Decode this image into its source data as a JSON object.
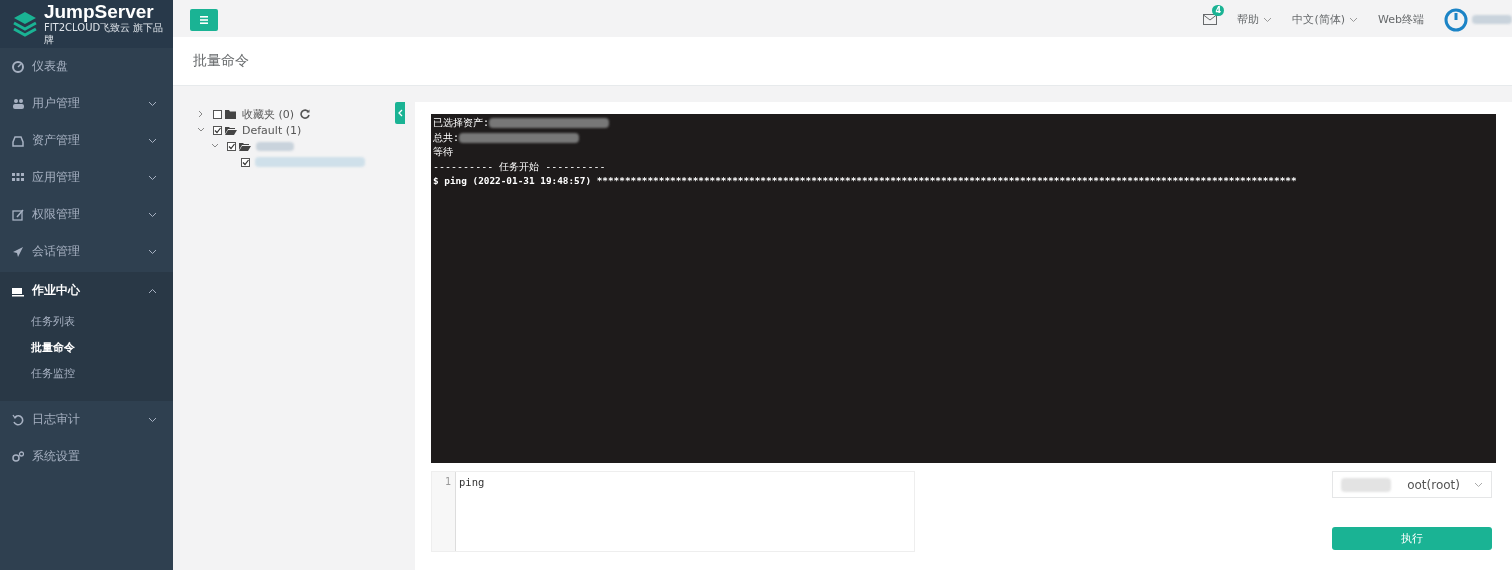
{
  "brand": {
    "name": "JumpServer",
    "tagline": "FIT2CLOUD飞致云 旗下品牌"
  },
  "sidebar": {
    "items": [
      {
        "label": "仪表盘",
        "expandable": false,
        "expanded": false
      },
      {
        "label": "用户管理",
        "expandable": true,
        "expanded": false
      },
      {
        "label": "资产管理",
        "expandable": true,
        "expanded": false
      },
      {
        "label": "应用管理",
        "expandable": true,
        "expanded": false
      },
      {
        "label": "权限管理",
        "expandable": true,
        "expanded": false
      },
      {
        "label": "会话管理",
        "expandable": true,
        "expanded": false
      },
      {
        "label": "作业中心",
        "expandable": true,
        "expanded": true,
        "children": [
          {
            "label": "任务列表",
            "selected": false
          },
          {
            "label": "批量命令",
            "selected": true
          },
          {
            "label": "任务监控",
            "selected": false
          }
        ]
      },
      {
        "label": "日志审计",
        "expandable": true,
        "expanded": false
      },
      {
        "label": "系统设置",
        "expandable": false,
        "expanded": false
      }
    ]
  },
  "topbar": {
    "notification_count": "4",
    "help": "帮助",
    "language": "中文(简体)",
    "web_terminal": "Web终端"
  },
  "page_title": "批量命令",
  "tree": [
    {
      "label": "收藏夹 (0)",
      "checked": false,
      "expanded": false,
      "refreshable": true
    },
    {
      "label": "Default (1)",
      "checked": true,
      "expanded": true,
      "children": [
        {
          "checked": true,
          "expanded": true,
          "children": [
            {
              "checked": true,
              "leaf": true
            }
          ]
        }
      ]
    }
  ],
  "terminal": {
    "lines": [
      {
        "kind": "output",
        "text": "已选择资产:",
        "redacted": true
      },
      {
        "kind": "output",
        "text": "总共:",
        "redacted": true
      },
      {
        "kind": "output",
        "text": "等待",
        "redacted": false
      },
      {
        "kind": "output",
        "text": "---------- 任务开始 ----------",
        "redacted": false
      },
      {
        "kind": "command",
        "text": "$ ping (2022-01-31 19:48:57) ****************************************************************************************************************************",
        "redacted": false
      }
    ]
  },
  "editor": {
    "lines": [
      {
        "number": "1",
        "text": "ping"
      }
    ]
  },
  "run_as": {
    "value": "oot(root)"
  },
  "run_button": "执行"
}
